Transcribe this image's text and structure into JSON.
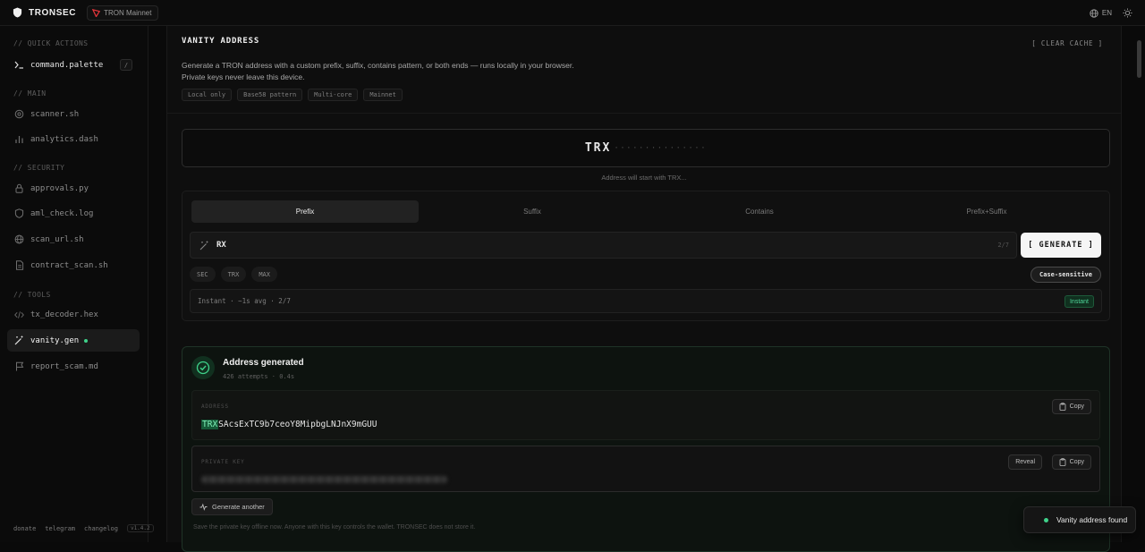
{
  "app": {
    "name": "TRONSEC",
    "network": "TRON Mainnet",
    "language": "EN"
  },
  "sidebar": {
    "sections": [
      {
        "label": "// QUICK ACTIONS",
        "items": [
          {
            "label": "command.palette",
            "icon": "terminal-icon",
            "shortcut": "/"
          }
        ]
      },
      {
        "label": "// MAIN",
        "items": [
          {
            "label": "scanner.sh",
            "icon": "scanner-icon"
          },
          {
            "label": "analytics.dash",
            "icon": "bar-chart-icon"
          }
        ]
      },
      {
        "label": "// SECURITY",
        "items": [
          {
            "label": "approvals.py",
            "icon": "lock-icon"
          },
          {
            "label": "aml_check.log",
            "icon": "shield-icon"
          },
          {
            "label": "scan_url.sh",
            "icon": "globe-icon"
          },
          {
            "label": "contract_scan.sh",
            "icon": "document-icon"
          }
        ]
      },
      {
        "label": "// TOOLS",
        "items": [
          {
            "label": "tx_decoder.hex",
            "icon": "code-icon"
          },
          {
            "label": "vanity.gen",
            "icon": "wand-icon",
            "active": true
          },
          {
            "label": "report_scam.md",
            "icon": "flag-icon"
          }
        ]
      }
    ],
    "footer": {
      "donate": "donate",
      "telegram": "telegram",
      "changelog": "changelog",
      "version": "v1.4.2"
    }
  },
  "page": {
    "title": "VANITY ADDRESS",
    "clear_cache": "[ CLEAR CACHE ]",
    "description": "Generate a TRON address with a custom prefix, suffix, contains pattern, or both ends — runs locally in your browser. Private keys never leave this device.",
    "tags": [
      "Local only",
      "Base58 pattern",
      "Multi-core",
      "Mainnet"
    ]
  },
  "preview": {
    "prefix": "TRX",
    "dots": "···············",
    "hint": "Address will start with TRX..."
  },
  "mode": {
    "tabs": [
      "Prefix",
      "Suffix",
      "Contains",
      "Prefix+Suffix"
    ],
    "active_tab": "Prefix",
    "pattern_value": "RX",
    "pattern_count": "2/7",
    "generate_label": "[ GENERATE ]",
    "presets": [
      "SEC",
      "TRX",
      "MAX"
    ],
    "case_sensitive_label": "Case-sensitive",
    "estimate": "Instant · ~1s avg · 2/7",
    "estimate_badge": "Instant"
  },
  "result": {
    "title": "Address generated",
    "meta": "426 attempts · 0.4s",
    "address_label": "ADDRESS",
    "address_prefix": "TRX",
    "address_rest": "SAcsExTC9b7ceoY8MipbgLNJnX9mGUU",
    "copy_label": "Copy",
    "private_key_label": "PRIVATE KEY",
    "reveal_label": "Reveal",
    "generate_another_label": "Generate another",
    "warning": "Save the private key offline now. Anyone with this key controls the wallet. TRONSEC does not store it."
  },
  "toast": {
    "text": "Vanity address found"
  },
  "colors": {
    "accent_green": "#3fd28a",
    "tron_red": "#e0343a"
  }
}
